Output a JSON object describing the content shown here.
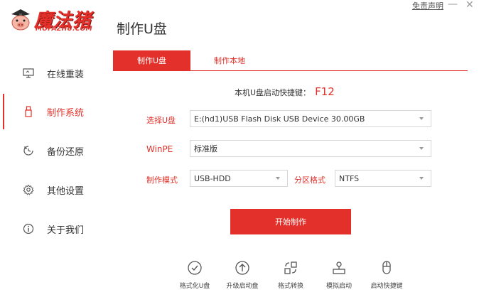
{
  "header": {
    "logo_text": "魔法猪",
    "logo_sub": "MOFAZHU.COM",
    "page_title": "制作U盘",
    "disclaimer": "免责声明",
    "minimize": "—",
    "close": "✕"
  },
  "sidebar": {
    "items": [
      {
        "label": "在线重装",
        "icon": "monitor-icon"
      },
      {
        "label": "制作系统",
        "icon": "usb-drive-icon"
      },
      {
        "label": "备份还原",
        "icon": "backup-icon"
      },
      {
        "label": "其他设置",
        "icon": "gear-icon"
      },
      {
        "label": "关于我们",
        "icon": "info-icon"
      }
    ],
    "active_index": 1
  },
  "tabs": [
    {
      "label": "制作U盘",
      "active": true
    },
    {
      "label": "制作本地",
      "active": false
    }
  ],
  "hotkey": {
    "label": "本机U盘启动快捷键：",
    "key": "F12"
  },
  "form": {
    "usb_label": "选择U盘",
    "usb_value": "E:(hd1)USB Flash Disk USB Device 30.00GB",
    "winpe_label": "WinPE",
    "winpe_value": "标准版",
    "mode_label": "制作模式",
    "mode_value": "USB-HDD",
    "partition_label": "分区格式",
    "partition_value": "NTFS"
  },
  "start_button": "开始制作",
  "tools": [
    {
      "label": "格式化U盘",
      "icon": "format-check-icon"
    },
    {
      "label": "升级启动盘",
      "icon": "upgrade-arrow-icon"
    },
    {
      "label": "格式转换",
      "icon": "convert-icon"
    },
    {
      "label": "模拟启动",
      "icon": "simulate-boot-icon"
    },
    {
      "label": "启动快捷键",
      "icon": "mouse-icon"
    }
  ],
  "colors": {
    "accent": "#e3302a"
  }
}
